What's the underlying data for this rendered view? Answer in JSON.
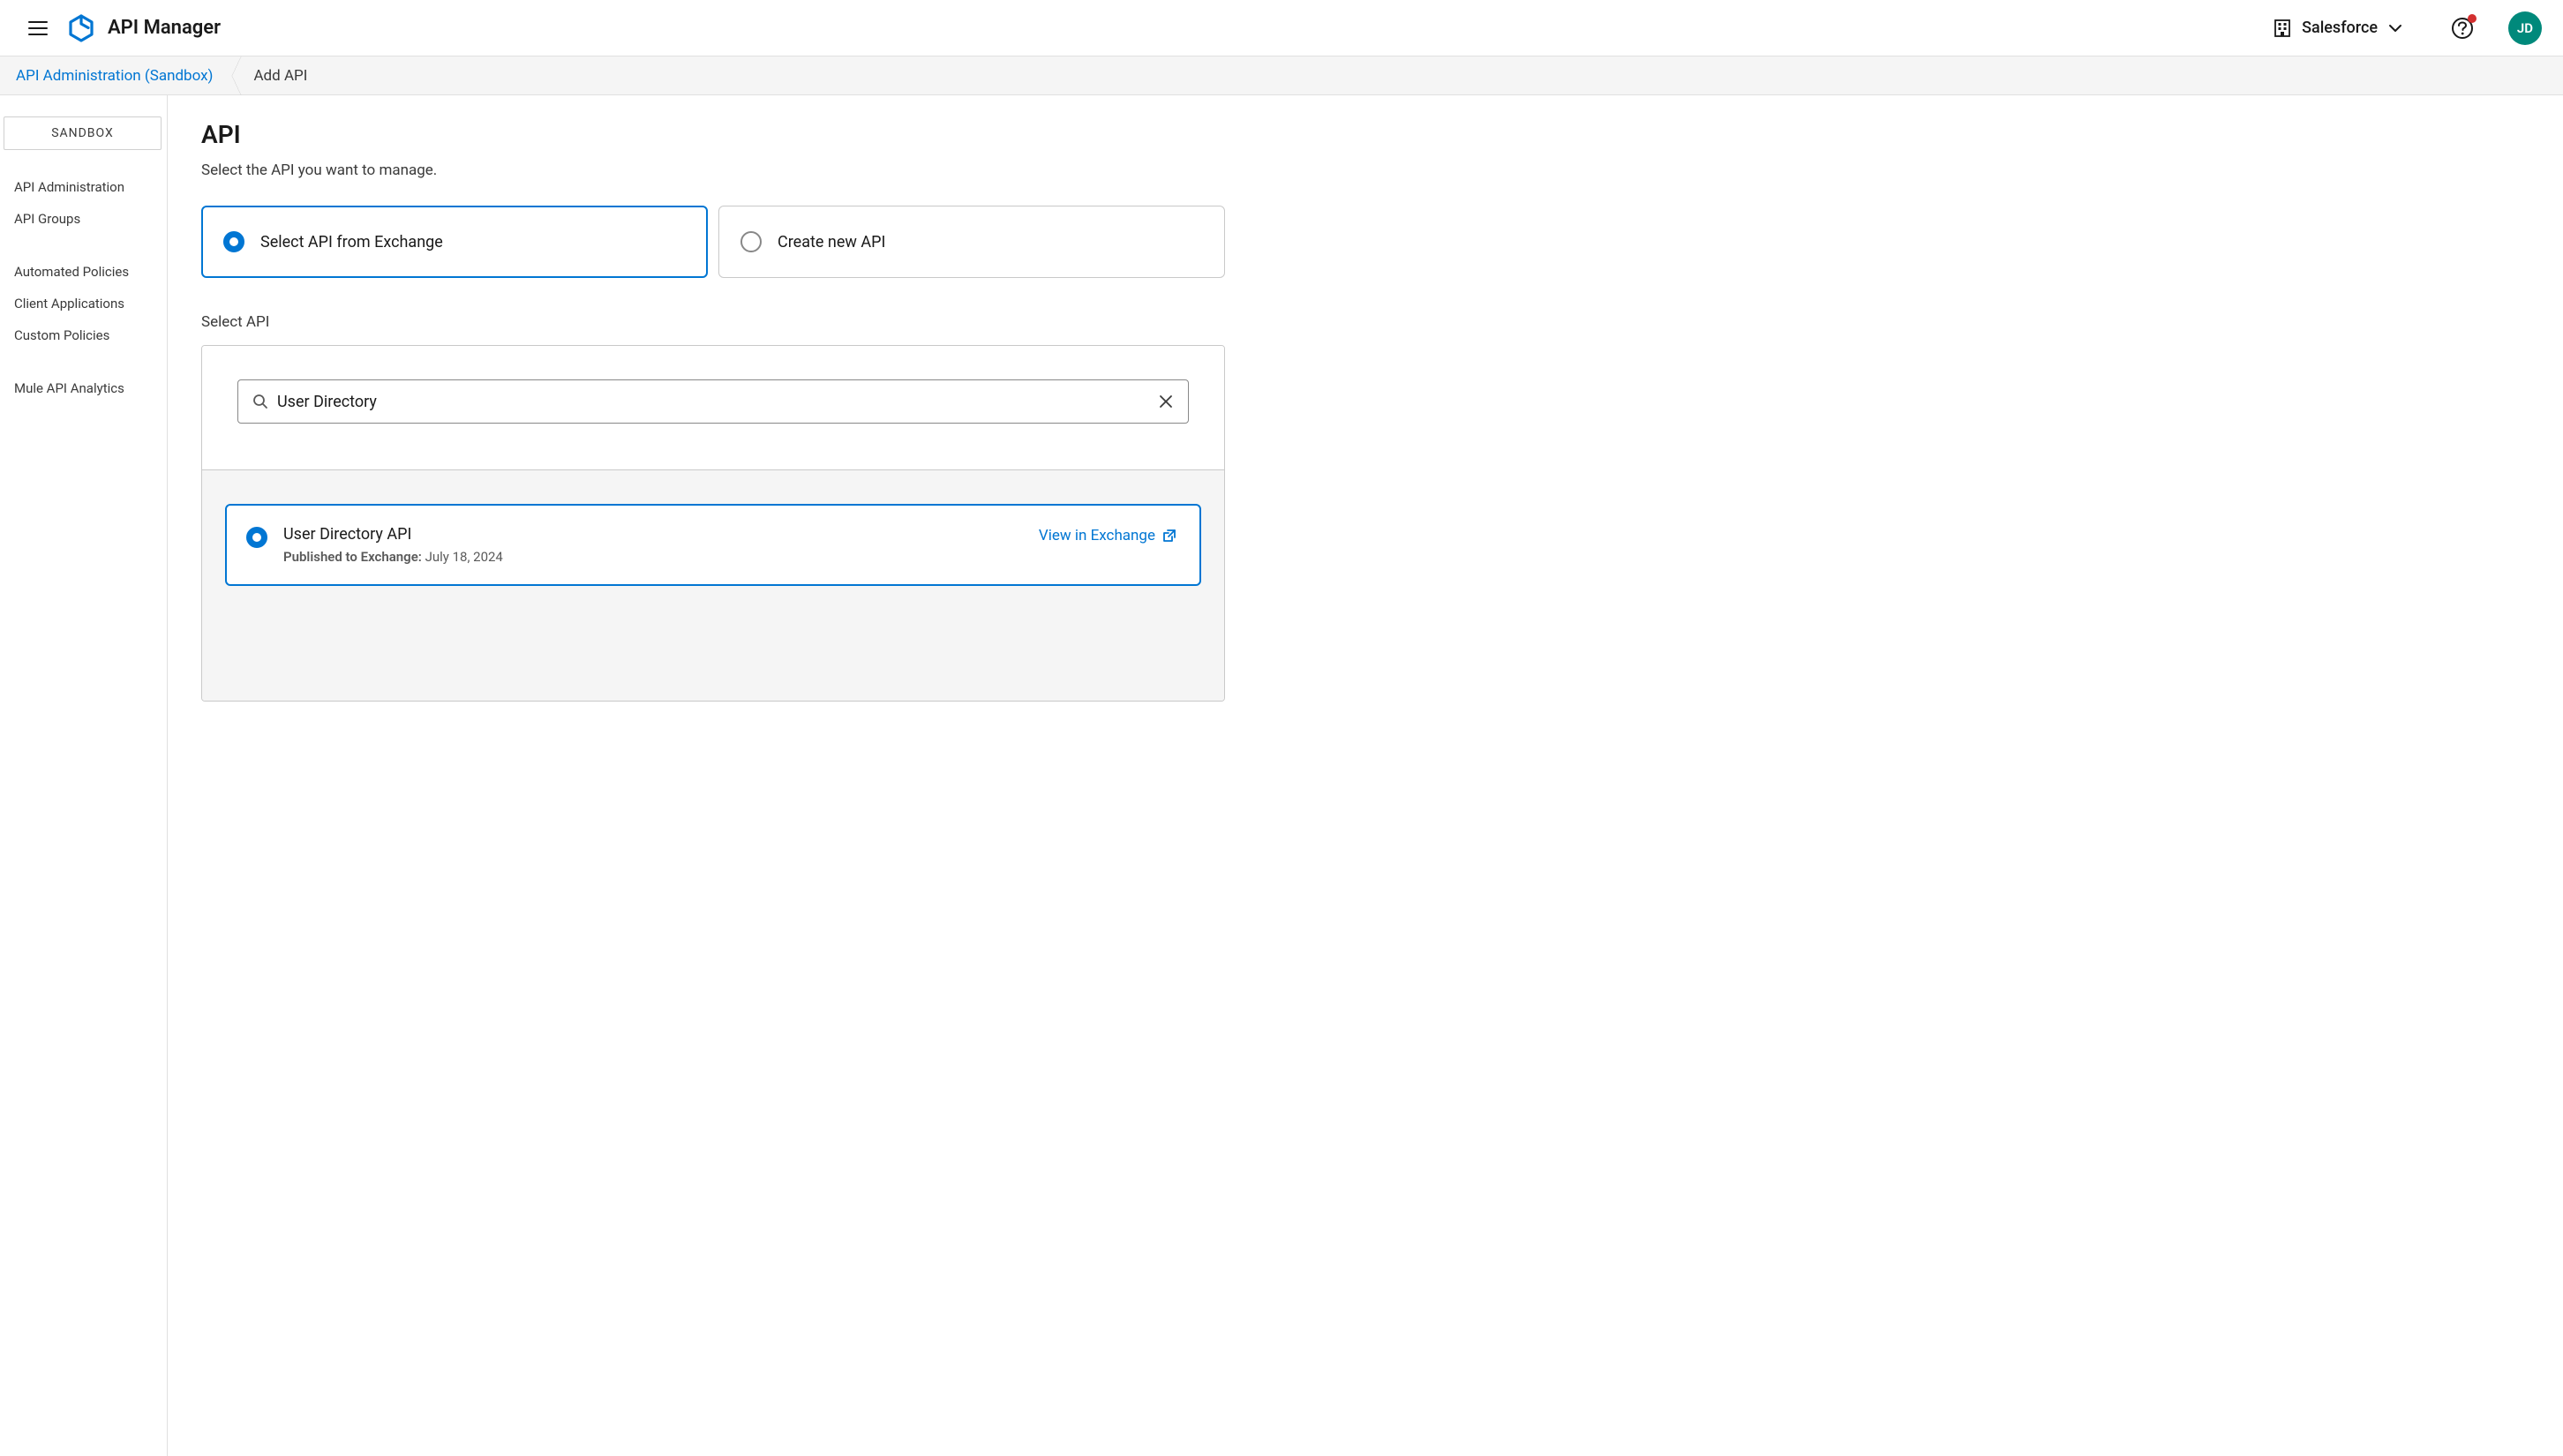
{
  "header": {
    "app_title": "API Manager",
    "org_name": "Salesforce",
    "avatar_initials": "JD"
  },
  "breadcrumb": {
    "root": "API Administration (Sandbox)",
    "current": "Add API"
  },
  "sidebar": {
    "env_label": "SANDBOX",
    "groups": [
      {
        "items": [
          "API Administration",
          "API Groups"
        ]
      },
      {
        "items": [
          "Automated Policies",
          "Client Applications",
          "Custom Policies"
        ]
      },
      {
        "items": [
          "Mule API Analytics"
        ]
      }
    ]
  },
  "main": {
    "title": "API",
    "subtitle": "Select the API you want to manage.",
    "options": {
      "from_exchange": "Select API from Exchange",
      "create_new": "Create new API"
    },
    "select_section_label": "Select API",
    "search_value": "User Directory",
    "result": {
      "title": "User Directory API",
      "published_label": "Published to Exchange:",
      "published_date": "July 18, 2024",
      "view_link": "View in Exchange"
    }
  }
}
